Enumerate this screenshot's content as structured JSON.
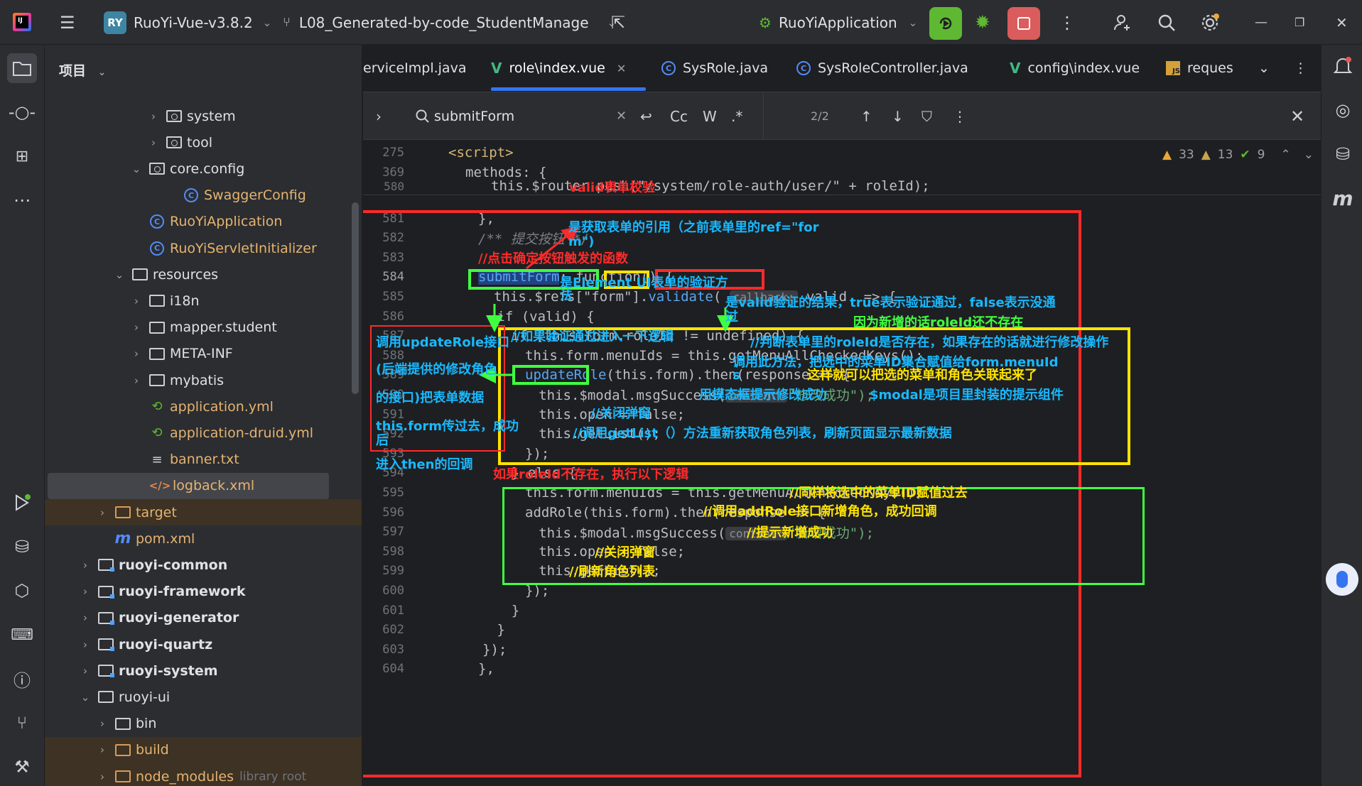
{
  "titlebar": {
    "project_badge": "RY",
    "project_name": "RuoYi-Vue-v3.8.2",
    "branch": "L08_Generated-by-code_StudentManage",
    "run_config": "RuoYiApplication"
  },
  "project_panel": {
    "title": "项目",
    "rows": [
      {
        "label": "system",
        "indent": 5,
        "icon": "folder-package",
        "chev": "›"
      },
      {
        "label": "tool",
        "indent": 5,
        "icon": "folder-package",
        "chev": "›"
      },
      {
        "label": "core.config",
        "indent": 4,
        "icon": "folder-package",
        "chev": "⌄"
      },
      {
        "label": "SwaggerConfig",
        "indent": 6,
        "icon": "class",
        "chev": ""
      },
      {
        "label": "RuoYiApplication",
        "indent": 4,
        "icon": "class",
        "chev": ""
      },
      {
        "label": "RuoYiServletInitializer",
        "indent": 4,
        "icon": "class",
        "chev": ""
      },
      {
        "label": "resources",
        "indent": 3,
        "icon": "folder",
        "chev": "⌄"
      },
      {
        "label": "i18n",
        "indent": 4,
        "icon": "folder",
        "chev": "›"
      },
      {
        "label": "mapper.student",
        "indent": 4,
        "icon": "folder",
        "chev": "›"
      },
      {
        "label": "META-INF",
        "indent": 4,
        "icon": "folder",
        "chev": "›"
      },
      {
        "label": "mybatis",
        "indent": 4,
        "icon": "folder",
        "chev": "›"
      },
      {
        "label": "application.yml",
        "indent": 4,
        "icon": "yml",
        "chev": ""
      },
      {
        "label": "application-druid.yml",
        "indent": 4,
        "icon": "yml",
        "chev": ""
      },
      {
        "label": "banner.txt",
        "indent": 4,
        "icon": "txt",
        "chev": ""
      },
      {
        "label": "logback.xml",
        "indent": 4,
        "icon": "xml",
        "chev": ""
      },
      {
        "label": "target",
        "indent": 2,
        "icon": "folder-excluded",
        "chev": "›"
      },
      {
        "label": "pom.xml",
        "indent": 2,
        "icon": "maven",
        "chev": ""
      },
      {
        "label": "ruoyi-common",
        "indent": 1,
        "icon": "module",
        "chev": "›"
      },
      {
        "label": "ruoyi-framework",
        "indent": 1,
        "icon": "module",
        "chev": "›"
      },
      {
        "label": "ruoyi-generator",
        "indent": 1,
        "icon": "module",
        "chev": "›"
      },
      {
        "label": "ruoyi-quartz",
        "indent": 1,
        "icon": "module",
        "chev": "›"
      },
      {
        "label": "ruoyi-system",
        "indent": 1,
        "icon": "module",
        "chev": "›"
      },
      {
        "label": "ruoyi-ui",
        "indent": 1,
        "icon": "folder",
        "chev": "⌄"
      },
      {
        "label": "bin",
        "indent": 2,
        "icon": "folder",
        "chev": "›"
      },
      {
        "label": "build",
        "indent": 2,
        "icon": "folder-excluded",
        "chev": "›"
      },
      {
        "label": "node_modules",
        "indent": 2,
        "icon": "folder-excluded",
        "chev": "›",
        "suffix": "library root"
      }
    ]
  },
  "tabs": [
    {
      "label": "erviceImpl.java",
      "icon": "class",
      "active": false,
      "closable": false
    },
    {
      "label": "role\\index.vue",
      "icon": "vue",
      "active": true,
      "closable": true
    },
    {
      "label": "SysRole.java",
      "icon": "class",
      "active": false,
      "closable": false
    },
    {
      "label": "SysRoleController.java",
      "icon": "class",
      "active": false,
      "closable": false
    },
    {
      "label": "config\\index.vue",
      "icon": "vue",
      "active": false,
      "closable": false
    },
    {
      "label": "reques",
      "icon": "js",
      "active": false,
      "closable": false
    }
  ],
  "find": {
    "query": "submitForm",
    "match_case": "Cc",
    "words": "W",
    "regex": ".*",
    "count": "2/2"
  },
  "inspections": {
    "warnings": "33",
    "weak_warnings": "13",
    "ok": "9"
  },
  "code": {
    "sticky": [
      {
        "n": "275",
        "text": "<script>"
      },
      {
        "n": "369",
        "text": "methods: {"
      }
    ],
    "line_580": "this.$router.push(\"/system/role-auth/user/\" + roleId);",
    "line_numbers": [
      "581",
      "582",
      "583",
      "584",
      "585",
      "586",
      "587",
      "588",
      "589",
      "590",
      "591",
      "592",
      "593",
      "594",
      "595",
      "596",
      "597",
      "598",
      "599",
      "600",
      "601",
      "602",
      "603",
      "604"
    ],
    "l581": "},",
    "l582": "/** 提交按钮 */",
    "l583": "//点击确定按钮触发的函数",
    "l584a": "submitForm",
    "l584b": ": function() {",
    "l585a": "this.$refs[\"form\"]",
    "l585b": "validate",
    "l585hint": "callback:",
    "l585c": "valid",
    "l585d": " => {",
    "l586": "if (valid) {",
    "l587": "if (this.form.roleId != undefined) {",
    "l588": "this.form.menuIds = this.getMenuAllCheckedKeys();",
    "l589a": "updateRole",
    "l589b": "(this.form).then(response => {",
    "l590a": "this.$modal.msgSuccess(",
    "l590hint": "content:",
    "l590b": "\"修改成功\");",
    "l591": "this.open = false;",
    "l592": "this.getList();",
    "l593": "});",
    "l594": "} else {",
    "l595": "this.form.menuIds = this.getMenuAllCheckedKeys();",
    "l596": "addRole(this.form).then(response => {",
    "l597a": "this.$modal.msgSuccess(",
    "l597hint": "content:",
    "l597b": "\"新增成功\");",
    "l598": "this.open = false;",
    "l599": "this.getList();",
    "l600": "});",
    "l601": "}",
    "l602": "}",
    "l603": "});",
    "l604": "},"
  },
  "annotations": {
    "valid_title": "valid表单校验",
    "refs_note_1": "是获取表单的引用（之前表单里的ref=\"for",
    "refs_note_2": "m\")",
    "validate_note_1": "是Element UI表单的验证方",
    "validate_note_2": "法",
    "valid_note_1": "是valid验证的结果，true表示验证通过，false表示没通",
    "valid_note_2": "过",
    "if_valid_note": "//如果验证通过进入一下逻辑",
    "roleid_missing_note": "因为新增的话roleId还不存在",
    "roleid_check_note": "//判断表单里的roleId是否存在，如果存在的话就进行修改操作",
    "menuids_note_1": "调用此方法，把选中的菜单ID集合赋值给form.menuId",
    "menuids_note_2": "s",
    "menuids_note_3": "这样就可以把选的菜单和角色关联起来了",
    "update_note_1": "调用updateRole接口",
    "update_note_2": "(后端提供的修改角色",
    "update_note_3": "的接口)把表单数据",
    "update_note_4": "this.form传过去，成功",
    "update_note_5": "后",
    "update_note_6": "进入then的回调",
    "msg_note": "用模态框提示修改成功",
    "modal_note": "$modal是项目里封装的提示组件",
    "close_note": "//关闭弹窗",
    "getlist_note": "//调用getList（）方法重新获取角色列表，刷新页面显示最新数据",
    "else_note": "如果roleId不存在，执行以下逻辑",
    "menuids2_note": "//同样将选中的菜单ID赋值过去",
    "addrole_note": "//调用addRole接口新增角色，成功回调",
    "add_success_note": "//提示新增成功",
    "close2_note": "//关闭弹窗",
    "refresh_note": "//刷新角色列表"
  },
  "colors": {
    "red": "#ff2a2a",
    "yellow": "#ffe400",
    "green": "#40ff40",
    "blue": "#18b9ff",
    "run_green": "#5fb832",
    "stop_red": "#db5c5c"
  }
}
